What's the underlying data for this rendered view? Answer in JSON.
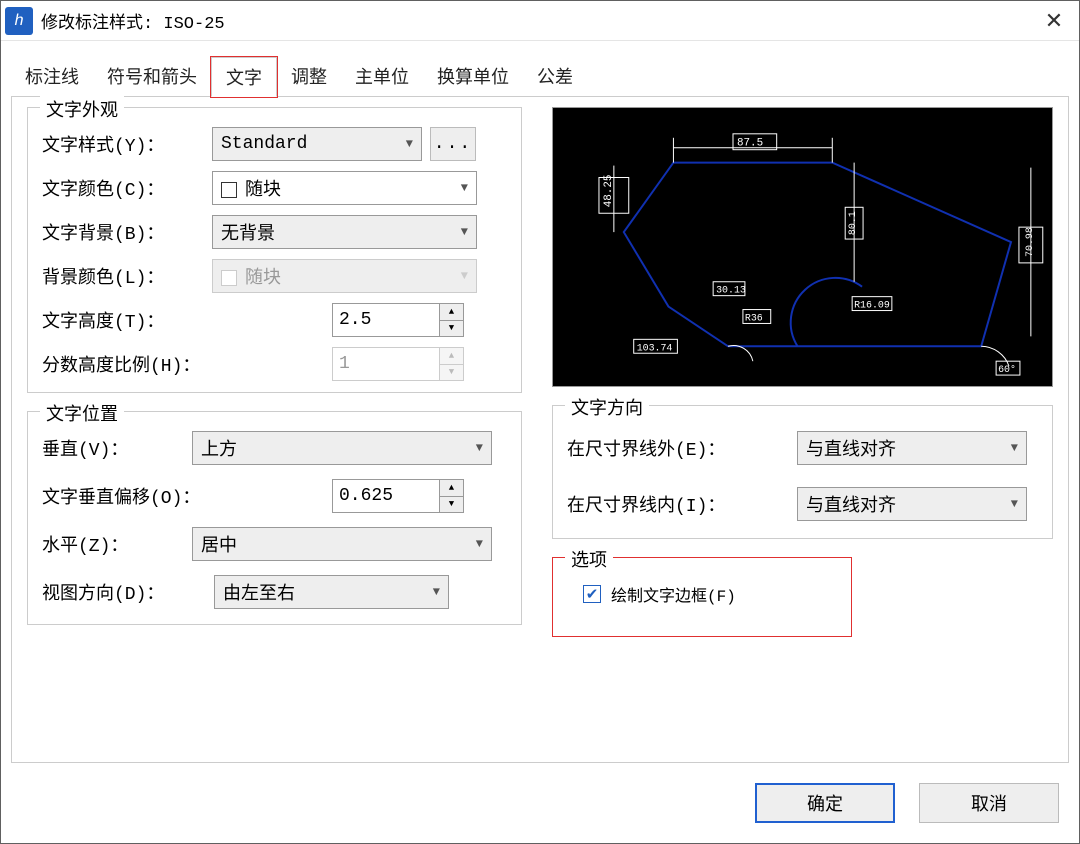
{
  "window": {
    "title": "修改标注样式: ISO-25"
  },
  "tabs": {
    "line": "标注线",
    "symbols": "符号和箭头",
    "text": "文字",
    "fit": "调整",
    "primary_units": "主单位",
    "alt_units": "换算单位",
    "tolerances": "公差"
  },
  "appearance": {
    "legend": "文字外观",
    "style_label": "文字样式(Y)：",
    "style_value": "Standard",
    "ellipsis_label": "...",
    "color_label": "文字颜色(C)：",
    "color_value": "随块",
    "bg_label": "文字背景(B)：",
    "bg_value": "无背景",
    "bgcolor_label": "背景颜色(L)：",
    "bgcolor_value": "随块",
    "height_label": "文字高度(T)：",
    "height_value": "2.5",
    "frac_label": "分数高度比例(H)：",
    "frac_value": "1"
  },
  "placement": {
    "legend": "文字位置",
    "vert_label": "垂直(V)：",
    "vert_value": "上方",
    "offset_label": "文字垂直偏移(O)：",
    "offset_value": "0.625",
    "horiz_label": "水平(Z)：",
    "horiz_value": "居中",
    "viewdir_label": "视图方向(D)：",
    "viewdir_value": "由左至右"
  },
  "alignment": {
    "legend": "文字方向",
    "outside_label": "在尺寸界线外(E)：",
    "outside_value": "与直线对齐",
    "inside_label": "在尺寸界线内(I)：",
    "inside_value": "与直线对齐"
  },
  "options": {
    "legend": "选项",
    "frame_label": "绘制文字边框(F)"
  },
  "preview_labels": {
    "d1": "87.5",
    "d2": "48.25",
    "d3": "80.1",
    "d4": "70.98",
    "d5": "30.13",
    "d6": "R36",
    "d7": "R16.09",
    "d8": "103.74",
    "d9": "60°"
  },
  "buttons": {
    "ok": "确定",
    "cancel": "取消"
  }
}
